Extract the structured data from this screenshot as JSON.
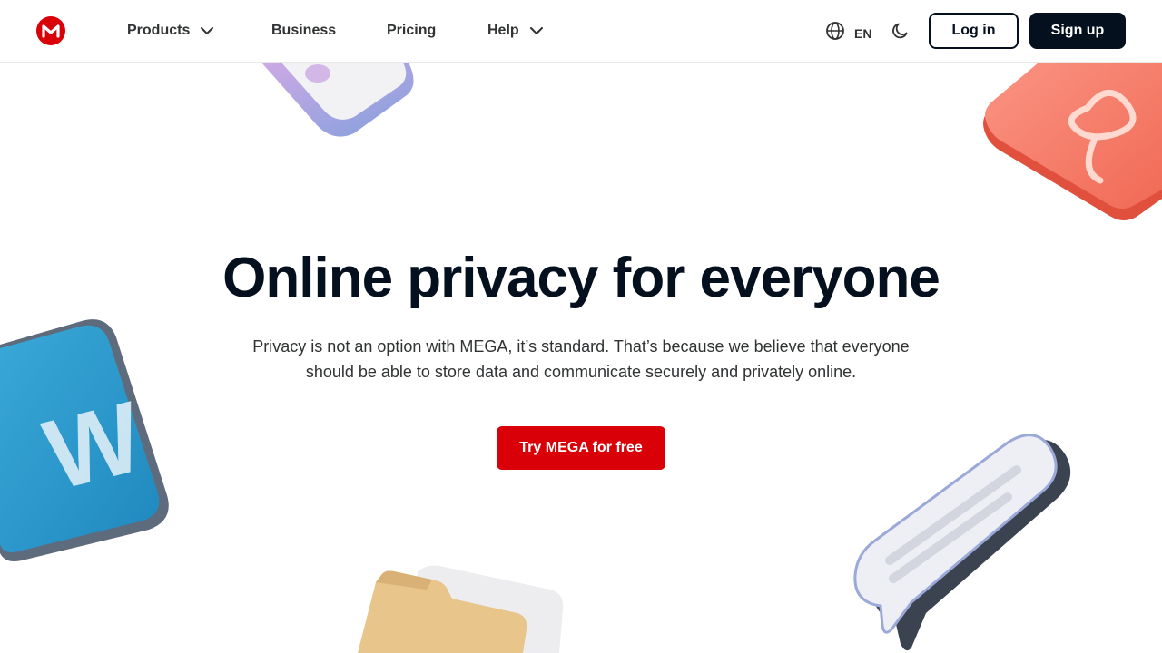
{
  "header": {
    "logo_letter": "M",
    "nav": {
      "products": "Products",
      "business": "Business",
      "pricing": "Pricing",
      "help": "Help"
    },
    "language": "EN",
    "login_label": "Log in",
    "signup_label": "Sign up"
  },
  "hero": {
    "title": "Online privacy for everyone",
    "subtitle_line1": "Privacy is not an option with MEGA, it’s standard. That’s because we believe that everyone",
    "subtitle_line2": "should be able to store data and communicate securely and privately online.",
    "cta_label": "Try MEGA for free"
  },
  "decorations": {
    "word_tile_letter": "W"
  },
  "colors": {
    "brand_red": "#d90007",
    "dark": "#04101e",
    "text": "#303233",
    "border": "#e6e8ea",
    "word_blue": "#2a97c9",
    "pdf_coral": "#f47563",
    "folder_tan": "#e8c58b",
    "purple_tile": "#b98ad6"
  },
  "icons": {
    "logo": "mega-logo-icon",
    "products_chevron": "chevron-down-icon",
    "help_chevron": "chevron-down-icon",
    "language": "globe-icon",
    "theme": "moon-icon"
  }
}
